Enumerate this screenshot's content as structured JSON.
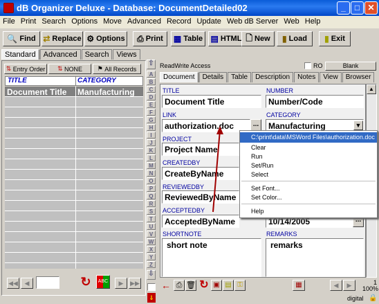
{
  "window": {
    "title": "dB Organizer Deluxe - Database: DocumentDetailed02",
    "buttons": {
      "minimize": "_",
      "maximize": "□",
      "close": "✕"
    }
  },
  "menu": [
    "File",
    "Print",
    "Search",
    "Options",
    "Move",
    "Advanced",
    "Record",
    "Update",
    "Web dB Server",
    "Web",
    "Help"
  ],
  "toolbar": {
    "find": "Find",
    "replace": "Replace",
    "options": "Options",
    "print": "Print",
    "table": "Table",
    "html": "HTML",
    "new": "New",
    "load": "Load",
    "exit": "Exit"
  },
  "left_tabs": [
    "Standard",
    "Advanced",
    "Search",
    "Views"
  ],
  "sort_buttons": [
    "Entry Order",
    "NONE",
    "All Records"
  ],
  "grid": {
    "headers": [
      "TITLE",
      "CATEGORY"
    ],
    "rows": [
      [
        "Document Title",
        "Manufacturing"
      ]
    ]
  },
  "left_footer": {
    "record_input": ""
  },
  "access": {
    "label": "ReadWrite Access",
    "ro": "RO",
    "blank": "Blank"
  },
  "alphabet": [
    "A",
    "B",
    "C",
    "D",
    "E",
    "F",
    "G",
    "H",
    "I",
    "J",
    "K",
    "L",
    "M",
    "N",
    "O",
    "P",
    "Q",
    "R",
    "S",
    "T",
    "U",
    "V",
    "W",
    "X",
    "Y",
    "Z"
  ],
  "right_tabs": [
    "Document",
    "Details",
    "Table",
    "Description",
    "Notes",
    "View",
    "Browser"
  ],
  "fields": {
    "title": {
      "label": "TITLE",
      "value": "Document Title"
    },
    "number": {
      "label": "NUMBER",
      "value": "Number/Code"
    },
    "link": {
      "label": "LINK",
      "value": "authorization.doc"
    },
    "category": {
      "label": "CATEGORY",
      "value": "Manufacturing"
    },
    "project": {
      "label": "PROJECT",
      "value": "Project Name"
    },
    "createdby": {
      "label": "CREATEDBY",
      "value": "CreateByName"
    },
    "reviewedby": {
      "label": "REVIEWEDBY",
      "value": "ReviewedByName"
    },
    "acceptedby": {
      "label": "ACCEPTEDBY",
      "value": "AcceptedByName"
    },
    "date": {
      "value": "10/14/2005"
    },
    "shortnote": {
      "label": "SHORTNOTE",
      "value": "short note"
    },
    "remarks": {
      "label": "REMARKS",
      "value": "remarks"
    },
    "ellipsis": "..."
  },
  "context_menu": {
    "header": "C:\\print\\data\\MSWord Files\\authorization.doc",
    "items": [
      "Clear",
      "Run",
      "Set/Run",
      "Select",
      "Set Font...",
      "Set Color...",
      "Help"
    ]
  },
  "status": {
    "page": "1",
    "zoom": "100%",
    "mode": "digital"
  },
  "colors": {
    "title_bar": "#0a5cd8",
    "highlight": "#316ac5",
    "label_blue": "#0000a0",
    "arrow_red": "#a00000"
  }
}
